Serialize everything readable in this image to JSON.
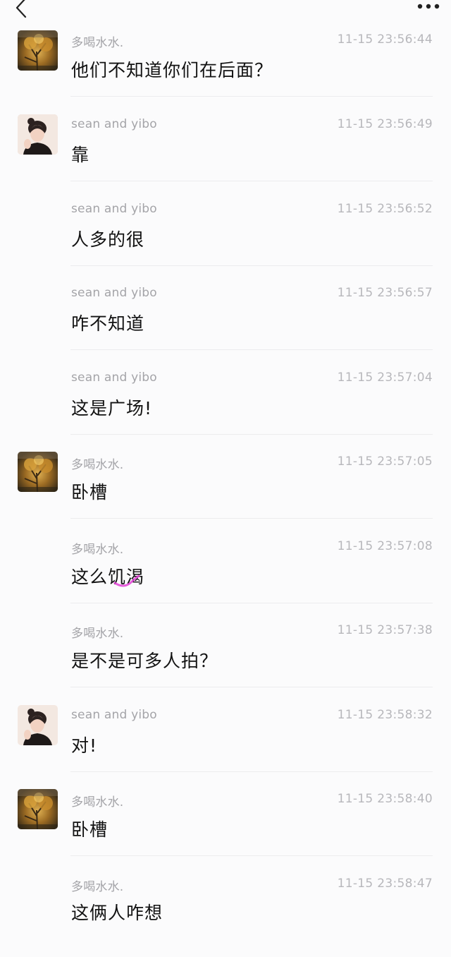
{
  "header": {
    "back_icon": "chevron-left-icon",
    "more_icon": "more-dots-icon"
  },
  "messages": [
    {
      "sender": "多喝水水.",
      "time": "11-15 23:56:44",
      "text": "他们不知道你们在后面？",
      "avatar": "autumn-tree"
    },
    {
      "sender": "sean and yibo",
      "time": "11-15 23:56:49",
      "text": "靠",
      "avatar": "girl-portrait"
    },
    {
      "sender": "sean and yibo",
      "time": "11-15 23:56:52",
      "text": "人多的很",
      "avatar": ""
    },
    {
      "sender": "sean and yibo",
      "time": "11-15 23:56:57",
      "text": "咋不知道",
      "avatar": ""
    },
    {
      "sender": "sean and yibo",
      "time": "11-15 23:57:04",
      "text": "这是广场!",
      "avatar": ""
    },
    {
      "sender": "多喝水水.",
      "time": "11-15 23:57:05",
      "text": "卧槽",
      "avatar": "autumn-tree"
    },
    {
      "sender": "多喝水水.",
      "time": "11-15 23:57:08",
      "text": "这么饥渴",
      "avatar": ""
    },
    {
      "sender": "多喝水水.",
      "time": "11-15 23:57:38",
      "text": "是不是可多人拍？",
      "avatar": ""
    },
    {
      "sender": "sean and yibo",
      "time": "11-15 23:58:32",
      "text": "对!",
      "avatar": "girl-portrait"
    },
    {
      "sender": "多喝水水.",
      "time": "11-15 23:58:40",
      "text": "卧槽",
      "avatar": "autumn-tree"
    },
    {
      "sender": "多喝水水.",
      "time": "11-15 23:58:47",
      "text": "这俩人咋想",
      "avatar": ""
    }
  ],
  "colors": {
    "background": "#fbfbfc",
    "sender": "#a4a4a8",
    "time": "#b7b7bb",
    "text": "#121212",
    "divider": "#ececee",
    "highlight": "#e23fd6"
  }
}
